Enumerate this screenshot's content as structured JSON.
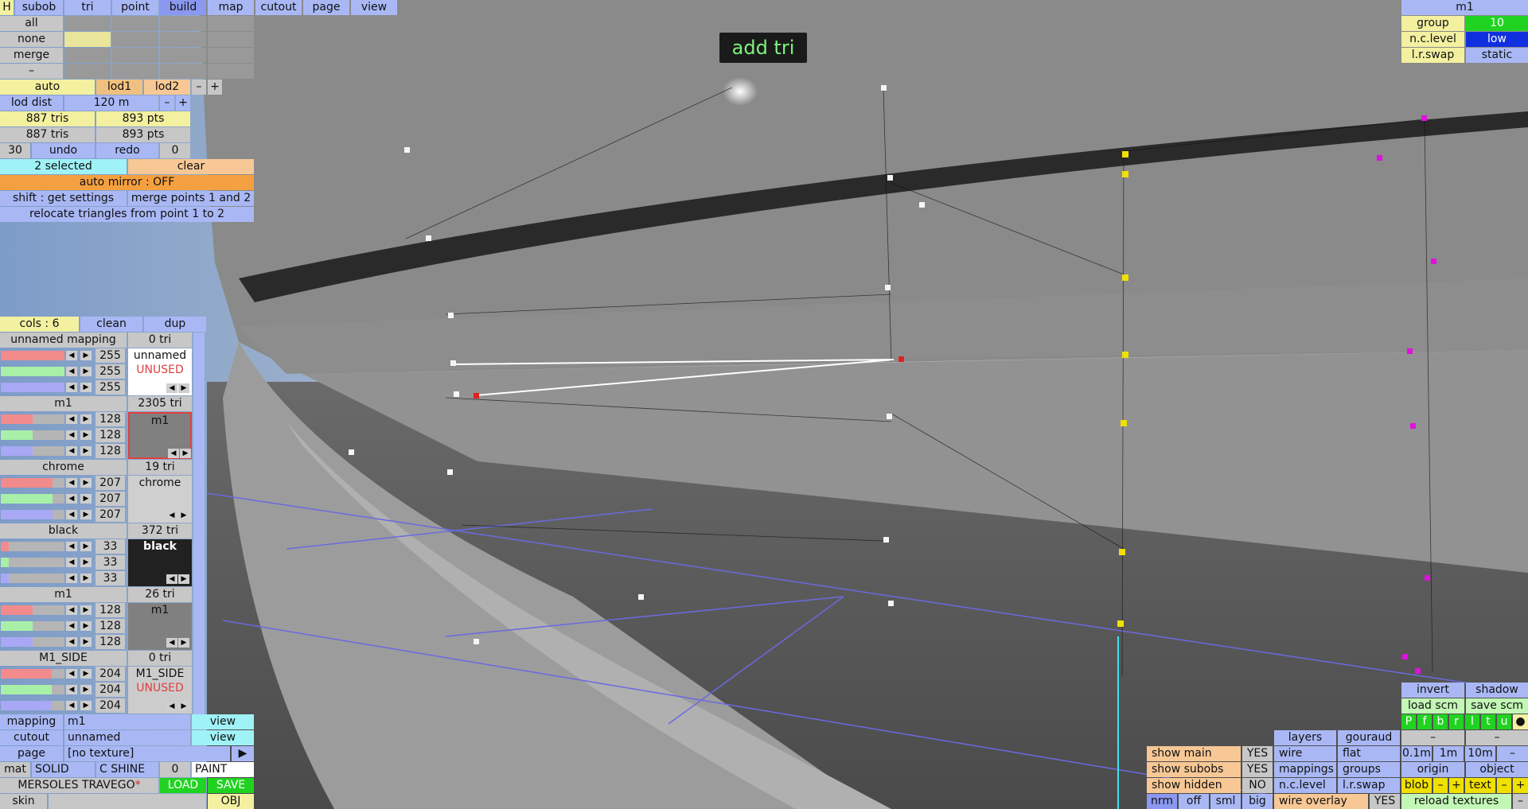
{
  "toolbar": {
    "h": "H",
    "tabs": [
      "subob",
      "tri",
      "point",
      "build",
      "map",
      "cutout",
      "page",
      "view"
    ],
    "active": "build"
  },
  "select_rows": [
    "all",
    "none",
    "merge",
    "–"
  ],
  "lod": {
    "auto": "auto",
    "lod1": "lod1",
    "lod2": "lod2",
    "minus": "–",
    "plus": "+"
  },
  "lod_dist": {
    "label": "lod dist",
    "value": "120 m",
    "minus": "–",
    "plus": "+"
  },
  "stats": {
    "tris1": "887 tris",
    "pts1": "893 pts",
    "tris2": "887 tris",
    "pts2": "893 pts"
  },
  "undo": {
    "count": "30",
    "undo": "undo",
    "redo": "redo",
    "redo_count": "0"
  },
  "selection": {
    "selected": "2 selected",
    "clear": "clear"
  },
  "auto_mirror": "auto mirror : OFF",
  "shift_hint": "shift : get settings",
  "merge_points": "merge points 1 and 2",
  "relocate": "relocate triangles from point 1 to 2",
  "cols": {
    "label": "cols : 6",
    "clean": "clean",
    "dup": "dup"
  },
  "materials": [
    {
      "name": "unnamed mapping",
      "tri": "0 tri",
      "r": "255",
      "g": "255",
      "b": "255",
      "swatch_name": "unnamed",
      "note": "UNUSED",
      "color": "#ffffff",
      "dark": false
    },
    {
      "name": "m1",
      "tri": "2305 tri",
      "r": "128",
      "g": "128",
      "b": "128",
      "swatch_name": "m1",
      "note": "",
      "color": "#808080",
      "dark": false
    },
    {
      "name": "chrome",
      "tri": "19 tri",
      "r": "207",
      "g": "207",
      "b": "207",
      "swatch_name": "chrome",
      "note": "",
      "color": "#cfcfcf",
      "dark": false
    },
    {
      "name": "black",
      "tri": "372 tri",
      "r": "33",
      "g": "33",
      "b": "33",
      "swatch_name": "black",
      "note": "",
      "color": "#212121",
      "dark": true
    },
    {
      "name": "m1",
      "tri": "26 tri",
      "r": "128",
      "g": "128",
      "b": "128",
      "swatch_name": "m1",
      "note": "",
      "color": "#808080",
      "dark": false
    },
    {
      "name": "M1_SIDE",
      "tri": "0 tri",
      "r": "204",
      "g": "204",
      "b": "204",
      "swatch_name": "M1_SIDE",
      "note": "UNUSED",
      "color": "#cccccc",
      "dark": false
    }
  ],
  "bottom_left": {
    "mapping_label": "mapping",
    "mapping_value": "m1",
    "view1": "view",
    "cutout_label": "cutout",
    "cutout_value": "unnamed",
    "view2": "view",
    "page_label": "page",
    "page_value": "[no texture]",
    "page_arrow": "▶",
    "mat": "mat",
    "solid": "SOLID",
    "cshine": "C SHINE",
    "cshine_val": "0",
    "paint": "PAINT",
    "model_name": "MERSOLES TRAVEGO",
    "modified_mark": "*",
    "load": "LOAD",
    "save": "SAVE",
    "skin": "skin",
    "obj": "OBJ"
  },
  "overlay": "add tri",
  "top_right": {
    "title": "m1",
    "group_label": "group",
    "group_value": "10",
    "nc_label": "n.c.level",
    "nc_value": "low",
    "lr_label": "l.r.swap",
    "lr_value": "static"
  },
  "bottom_right": {
    "invert": "invert",
    "shadow": "shadow",
    "load_scm": "load scm",
    "save_scm": "save scm",
    "flags": [
      "P",
      "f",
      "b",
      "r",
      "l",
      "t",
      "u",
      "●"
    ],
    "layers": "layers",
    "gouraud": "gouraud",
    "dash1": "–",
    "dash2": "–",
    "show_main": "show main",
    "show_main_v": "YES",
    "wire": "wire",
    "flat": "flat",
    "s01": "0.1m",
    "s1": "1m",
    "s10": "10m",
    "sm": "–",
    "show_subobs": "show subobs",
    "show_subobs_v": "YES",
    "mappings": "mappings",
    "groups": "groups",
    "origin": "origin",
    "object": "object",
    "show_hidden": "show hidden",
    "show_hidden_v": "NO",
    "nclevel": "n.c.level",
    "lrswap": "l.r.swap",
    "blob": "blob",
    "bm": "–",
    "bp": "+",
    "text": "text",
    "tm": "–",
    "tp": "+",
    "nrm": "nrm",
    "off": "off",
    "sml": "sml",
    "big": "big",
    "wire_overlay": "wire overlay",
    "wire_overlay_v": "YES",
    "reload": "reload textures",
    "rm": "–"
  }
}
